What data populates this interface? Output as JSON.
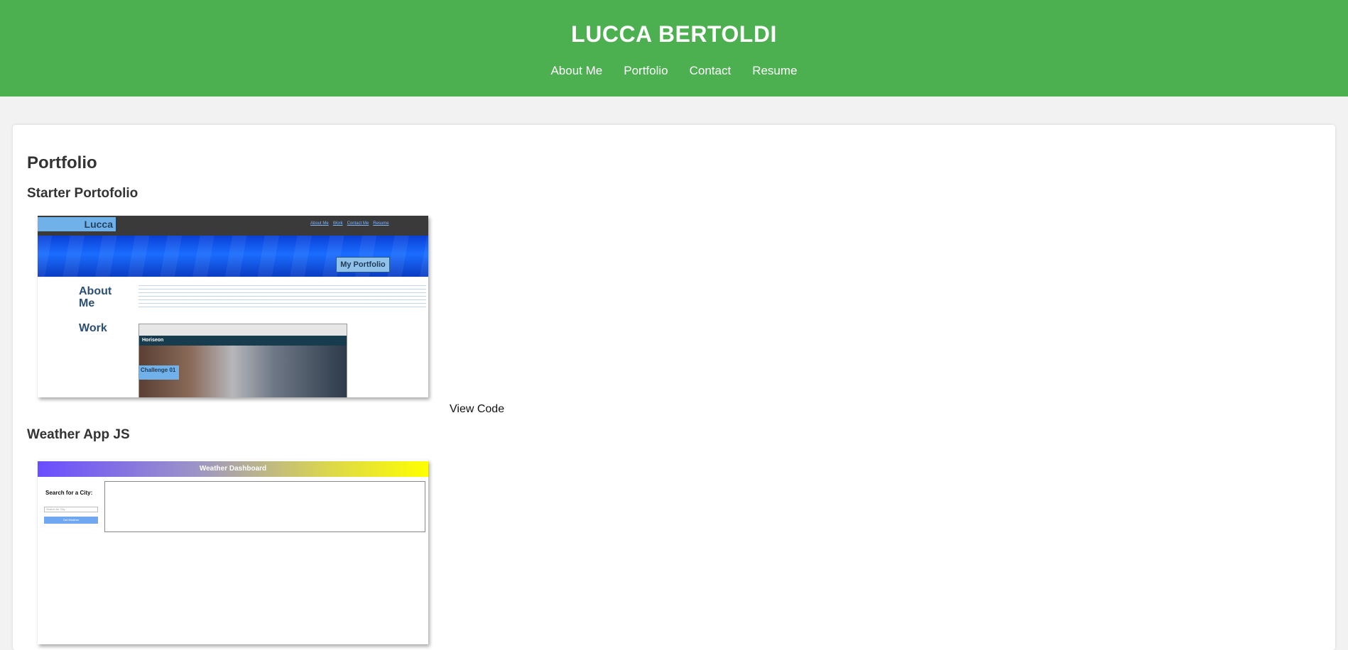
{
  "header": {
    "title": "LUCCA BERTOLDI",
    "nav": [
      "About Me",
      "Portfolio",
      "Contact",
      "Resume"
    ]
  },
  "main": {
    "section_title": "Portfolio",
    "projects": [
      {
        "title": "Starter Portofolio",
        "view_code_label": "View Code",
        "screenshot": {
          "logo": "Lucca",
          "links": [
            "About Me",
            "Work",
            "Contact Me",
            "Resume"
          ],
          "hero_badge": "My Portfolio",
          "about_heading": "About Me",
          "work_heading": "Work",
          "work_site_name": "Horiseon",
          "work_caption": "Challenge 01"
        }
      },
      {
        "title": "Weather App JS",
        "screenshot": {
          "banner": "Weather Dashboard",
          "search_label": "Search for a City:",
          "search_placeholder": "Search for City",
          "button_label": "Get Weather"
        }
      }
    ]
  },
  "colors": {
    "header_bg": "#4caf50",
    "page_bg": "#f2f2f2",
    "card_bg": "#ffffff"
  }
}
